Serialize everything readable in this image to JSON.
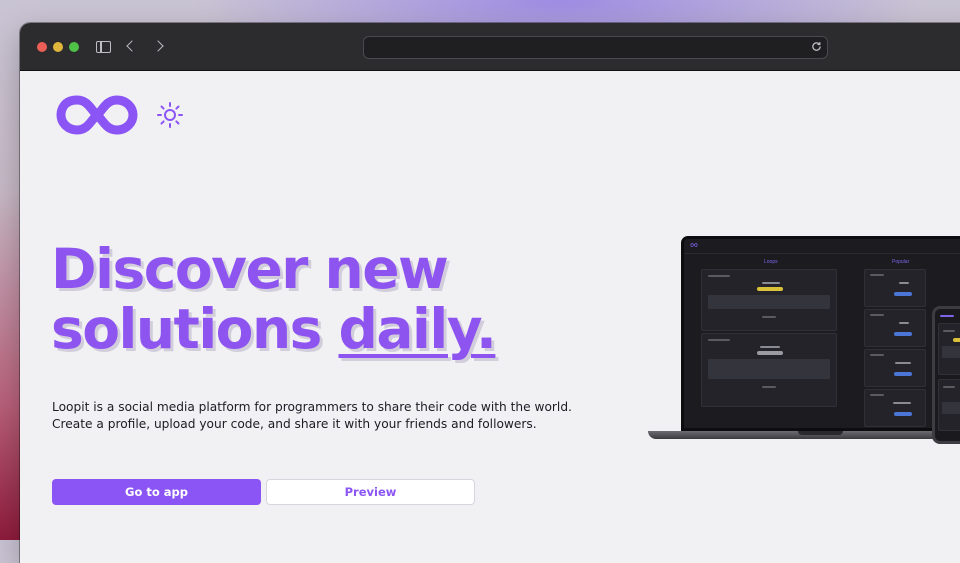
{
  "browser": {
    "url": ""
  },
  "hero": {
    "headline_line1": "Discover new",
    "headline_line2_plain": "solutions ",
    "headline_line2_underlined": "daily.",
    "description_line1": "Loopit is a social media platform for programmers to share their code with the world.",
    "description_line2": "Create a profile, upload your code, and share it with your friends and followers."
  },
  "buttons": {
    "primary_label": "Go to app",
    "secondary_label": "Preview"
  },
  "mockup": {
    "loops_title": "Loops",
    "popular_title": "Popular"
  },
  "colors": {
    "brand": "#8b55f5",
    "headline": "#8e54f0",
    "page_bg": "#f1f0f3",
    "titlebar": "#2c2b2e"
  },
  "icons": {
    "logo": "infinity-logo-icon",
    "theme": "sun-icon",
    "reload": "reload-icon"
  }
}
